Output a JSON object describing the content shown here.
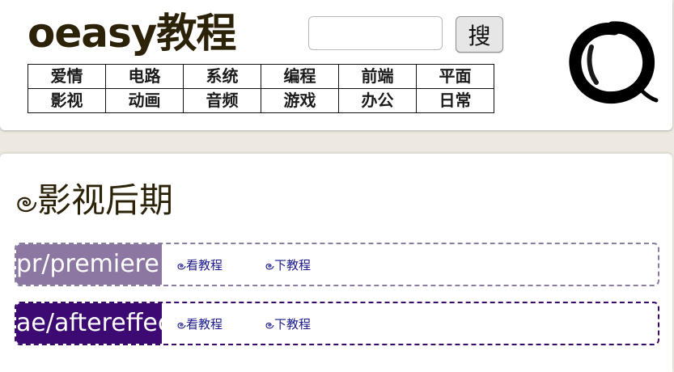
{
  "header": {
    "brand": "oeasy教程",
    "search": {
      "value": "",
      "placeholder": ""
    },
    "search_button_label": "搜",
    "logo_icon": "enso-ink-circle-icon"
  },
  "categories": [
    [
      "爱情",
      "电路",
      "系统",
      "编程",
      "前端",
      "平面"
    ],
    [
      "影视",
      "动画",
      "音频",
      "游戏",
      "办公",
      "日常"
    ]
  ],
  "section": {
    "title": "影视后期",
    "title_icon": "spiral-icon",
    "tutorials": [
      {
        "label": "pr/premiere",
        "view_label": "看教程",
        "download_label": "下教程",
        "color": "#8b77a1"
      },
      {
        "label": "ae/aftereffects",
        "view_label": "看教程",
        "download_label": "下教程",
        "color": "#3c0a72"
      }
    ]
  },
  "colors": {
    "background": "#ede9e1",
    "brand": "#2b2208",
    "link": "#1a1a8c"
  }
}
